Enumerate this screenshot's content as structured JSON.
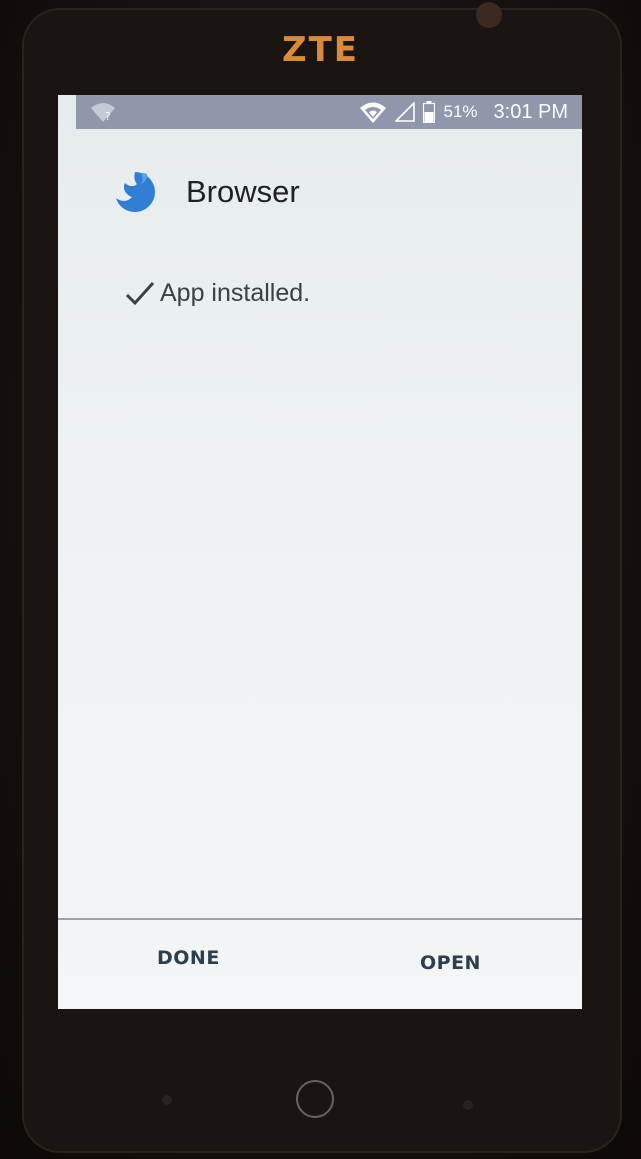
{
  "device": {
    "brand": "ZTE"
  },
  "statusbar": {
    "battery": "51%",
    "time": "3:01 PM",
    "icons": [
      "wifi-unknown-icon",
      "wifi-signal-icon",
      "cell-signal-icon",
      "battery-icon"
    ]
  },
  "dialog": {
    "app_name": "Browser",
    "app_icon": "browser-app-icon",
    "status_text": "App installed.",
    "status_icon": "check-icon",
    "buttons": {
      "done": "DONE",
      "open": "OPEN"
    }
  },
  "colors": {
    "statusbar": "#8e97ab",
    "screen": "#eef2f3",
    "app_icon": "#2f7fd4",
    "button_text": "#2c3e50",
    "brand": "#d98a3a"
  }
}
